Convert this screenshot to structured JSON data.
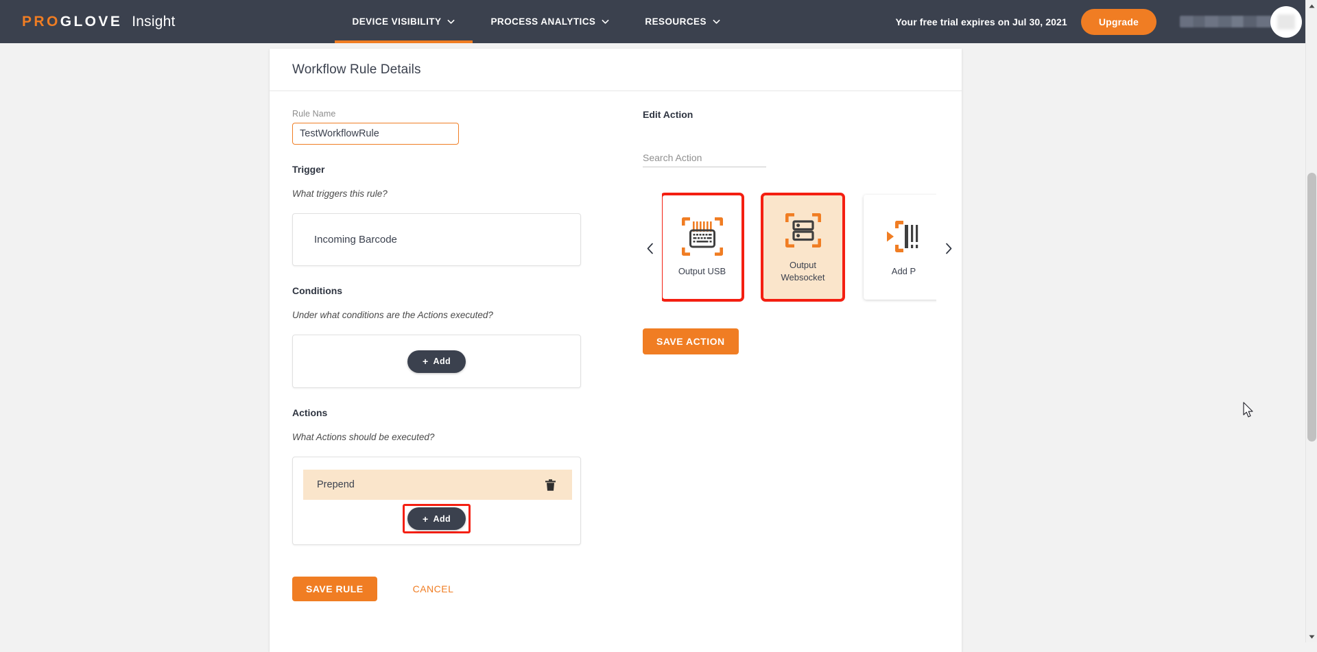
{
  "header": {
    "brand_pro": "PRO",
    "brand_glove": "GLOVE",
    "brand_product": "Insight",
    "nav_items": [
      {
        "label": "DEVICE VISIBILITY",
        "icon": "chevron-down-icon",
        "active": true
      },
      {
        "label": "PROCESS ANALYTICS",
        "icon": "chevron-down-icon",
        "active": false
      },
      {
        "label": "RESOURCES",
        "icon": "chevron-down-icon",
        "active": false
      }
    ],
    "trial_notice": "Your free trial expires on Jul 30, 2021",
    "upgrade_label": "Upgrade",
    "user_name": "",
    "avatar": "user-avatar"
  },
  "card": {
    "title": "Workflow Rule Details",
    "rule_name_label": "Rule Name",
    "rule_name_value": "TestWorkflowRule",
    "trigger": {
      "section_title": "Trigger",
      "question": "What triggers this rule?",
      "value": "Incoming Barcode"
    },
    "conditions": {
      "section_title": "Conditions",
      "question": "Under what conditions are the Actions executed?",
      "add_label": "Add",
      "add_plus": "+"
    },
    "actions": {
      "section_title": "Actions",
      "question": "What Actions should be executed?",
      "items": [
        {
          "name": "Prepend",
          "delete_icon": "trash-icon"
        }
      ],
      "add_label": "Add",
      "add_plus": "+"
    },
    "save_rule_label": "SAVE RULE",
    "cancel_label": "CANCEL"
  },
  "edit_action": {
    "title": "Edit Action",
    "search_placeholder": "Search Action",
    "search_value": "",
    "prev_arrow": "chevron-left-icon",
    "next_arrow": "chevron-right-icon",
    "cards": [
      {
        "label": "Output USB",
        "icon": "barcode-keyboard-icon",
        "selected": false,
        "highlighted": true
      },
      {
        "label": "Output\nWebsocket",
        "icon": "server-scan-icon",
        "selected": true,
        "highlighted": true
      },
      {
        "label": "Add P",
        "icon": "add-prefix-barcode-icon",
        "selected": false,
        "highlighted": false
      }
    ],
    "save_action_label": "SAVE ACTION"
  },
  "colors": {
    "brand_orange": "#f07d23",
    "nav_dark": "#3b414e",
    "highlight_red": "#f41f11",
    "selected_bg": "#fae5cb",
    "page_bg": "#f2f2f2"
  },
  "scrollbar": {
    "up_arrow": "scroll-up-arrow-icon",
    "down_arrow": "scroll-down-arrow-icon",
    "thumb": "scrollbar-thumb"
  }
}
